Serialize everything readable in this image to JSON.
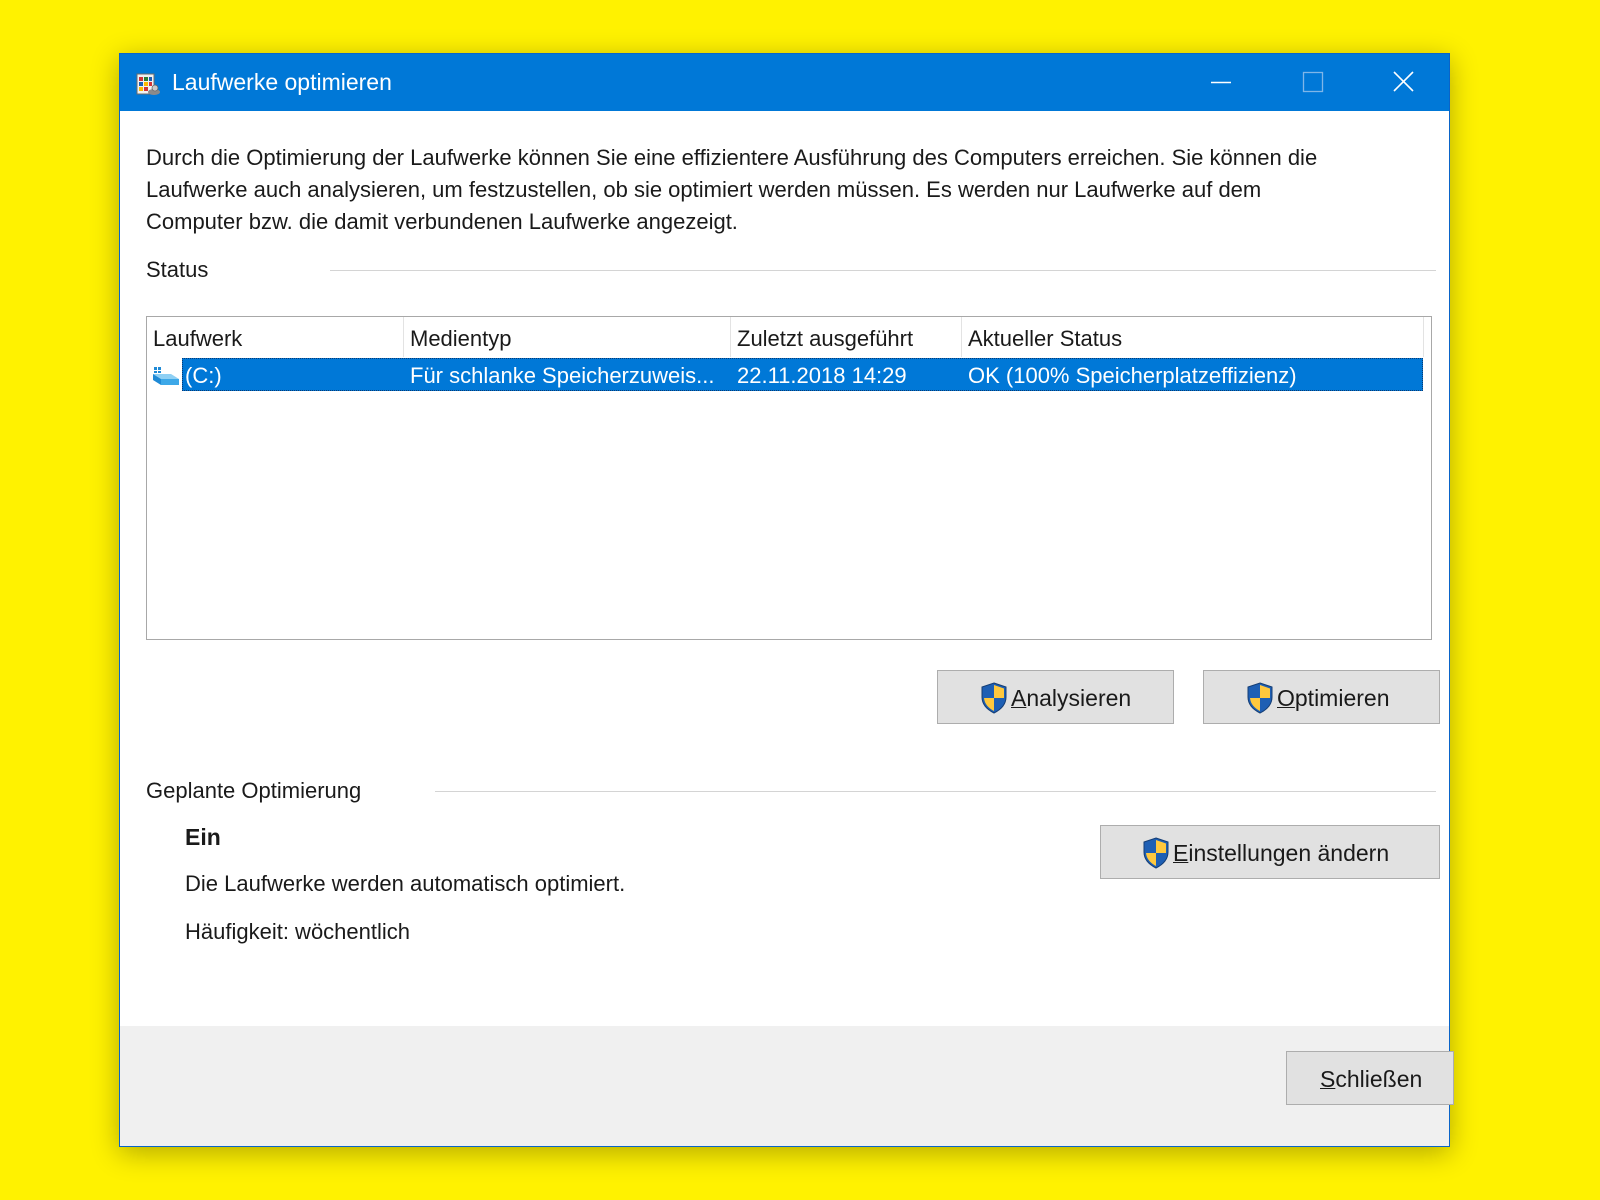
{
  "window": {
    "title": "Laufwerke optimieren",
    "title_icon": "defrag-app-icon",
    "controls": [
      "minimize-icon",
      "maximize-icon",
      "close-icon"
    ]
  },
  "description": "Durch die Optimierung der Laufwerke können Sie eine effizientere Ausführung des Computers erreichen. Sie können die Laufwerke auch analysieren, um festzustellen, ob sie optimiert werden müssen. Es werden nur Laufwerke auf dem Computer bzw. die damit verbundenen Laufwerke angezeigt.",
  "status": {
    "label": "Status",
    "columns": [
      "Laufwerk",
      "Medientyp",
      "Zuletzt ausgeführt",
      "Aktueller Status"
    ],
    "rows": [
      {
        "drive": "(C:)",
        "media_type": "Für schlanke Speicherzuweis...",
        "last_run": "22.11.2018 14:29",
        "current_status": "OK (100% Speicherplatzeffizienz)",
        "selected": true,
        "icon": "drive-icon"
      }
    ],
    "buttons": {
      "analyze": {
        "accel": "A",
        "rest": "nalysieren",
        "icon": "uac-shield-icon"
      },
      "optimize": {
        "accel": "O",
        "rest": "ptimieren",
        "icon": "uac-shield-icon"
      }
    }
  },
  "scheduled": {
    "label": "Geplante Optimierung",
    "state": "Ein",
    "info": "Die Laufwerke werden automatisch optimiert.",
    "frequency": "Häufigkeit: wöchentlich",
    "change_button": {
      "accel": "E",
      "rest": "instellungen ändern",
      "icon": "uac-shield-icon"
    }
  },
  "footer": {
    "close_button": {
      "accel": "S",
      "rest": "chließen"
    }
  },
  "colors": {
    "background": "#fff200",
    "titlebar": "#0078d7",
    "selection": "#0078d7",
    "button_face": "#e1e1e1",
    "footer": "#f0f0f0"
  }
}
